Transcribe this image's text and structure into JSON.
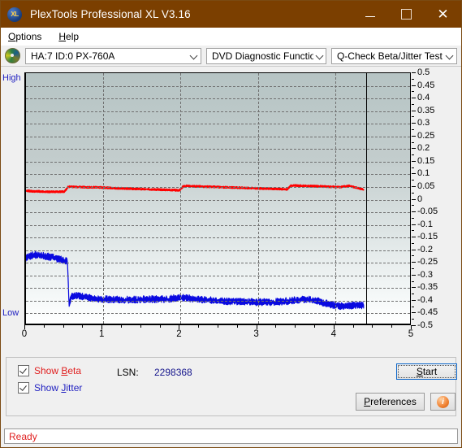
{
  "window": {
    "title": "PlexTools Professional XL V3.16",
    "logo_text": "XL",
    "minimize_label": "–",
    "maximize_label": "",
    "close_label": "✕"
  },
  "menu": {
    "items": [
      {
        "label": "Options",
        "accel": "O"
      },
      {
        "label": "Help",
        "accel": "H"
      }
    ]
  },
  "toolbar": {
    "drive_combo": {
      "value": "HA:7 ID:0  PX-760A",
      "icon": "disc-icon"
    },
    "function_combo": {
      "value": "DVD Diagnostic Functions"
    },
    "test_combo": {
      "value": "Q-Check Beta/Jitter Test"
    }
  },
  "chart_axis": {
    "high_label": "High",
    "low_label": "Low",
    "y_ticks": [
      "0.5",
      "0.45",
      "0.4",
      "0.35",
      "0.3",
      "0.25",
      "0.2",
      "0.15",
      "0.1",
      "0.05",
      "0",
      "-0.05",
      "-0.1",
      "-0.15",
      "-0.2",
      "-0.25",
      "-0.3",
      "-0.35",
      "-0.4",
      "-0.45",
      "-0.5"
    ],
    "x_ticks": [
      "0",
      "1",
      "2",
      "3",
      "4",
      "5"
    ]
  },
  "chart_data": {
    "type": "line",
    "title": "Q-Check Beta/Jitter Test",
    "xlabel": "",
    "ylabel": "",
    "xlim": [
      0,
      5
    ],
    "ylim": [
      -0.5,
      0.5
    ],
    "grid": true,
    "legend_position": "bottom-left",
    "cursor_x": 4.4,
    "series": [
      {
        "name": "Show Beta",
        "color": "#ff0000",
        "x": [
          0.0,
          0.1,
          0.2,
          0.3,
          0.4,
          0.5,
          0.55,
          0.6,
          0.7,
          0.8,
          0.9,
          1.0,
          1.1,
          1.2,
          1.3,
          1.4,
          1.5,
          1.6,
          1.7,
          1.8,
          1.9,
          2.0,
          2.05,
          2.1,
          2.2,
          2.3,
          2.4,
          2.5,
          2.6,
          2.7,
          2.8,
          2.9,
          3.0,
          3.1,
          3.2,
          3.3,
          3.4,
          3.45,
          3.5,
          3.6,
          3.7,
          3.8,
          3.9,
          4.0,
          4.1,
          4.2,
          4.3,
          4.4
        ],
        "y": [
          0.03,
          0.028,
          0.027,
          0.026,
          0.026,
          0.027,
          0.046,
          0.046,
          0.045,
          0.044,
          0.044,
          0.043,
          0.041,
          0.04,
          0.039,
          0.038,
          0.037,
          0.036,
          0.035,
          0.034,
          0.033,
          0.032,
          0.049,
          0.049,
          0.048,
          0.047,
          0.046,
          0.045,
          0.044,
          0.043,
          0.042,
          0.041,
          0.04,
          0.039,
          0.038,
          0.037,
          0.036,
          0.051,
          0.051,
          0.05,
          0.049,
          0.048,
          0.047,
          0.046,
          0.045,
          0.05,
          0.043,
          0.034
        ]
      },
      {
        "name": "Show Jitter",
        "color": "#0a0ae0",
        "x": [
          0.0,
          0.05,
          0.1,
          0.15,
          0.2,
          0.25,
          0.3,
          0.35,
          0.4,
          0.45,
          0.5,
          0.54,
          0.56,
          0.6,
          0.65,
          0.7,
          0.8,
          0.9,
          1.0,
          1.2,
          1.4,
          1.6,
          1.8,
          2.0,
          2.1,
          2.2,
          2.4,
          2.6,
          2.8,
          3.0,
          3.2,
          3.4,
          3.5,
          3.6,
          3.7,
          3.8,
          3.9,
          4.0,
          4.1,
          4.2,
          4.3,
          4.4
        ],
        "y": [
          -0.24,
          -0.232,
          -0.228,
          -0.226,
          -0.228,
          -0.232,
          -0.235,
          -0.238,
          -0.242,
          -0.246,
          -0.25,
          -0.252,
          -0.42,
          -0.392,
          -0.388,
          -0.392,
          -0.398,
          -0.402,
          -0.404,
          -0.406,
          -0.406,
          -0.404,
          -0.404,
          -0.398,
          -0.4,
          -0.404,
          -0.408,
          -0.412,
          -0.414,
          -0.416,
          -0.416,
          -0.412,
          -0.408,
          -0.404,
          -0.406,
          -0.412,
          -0.42,
          -0.428,
          -0.432,
          -0.43,
          -0.428,
          -0.428
        ]
      }
    ]
  },
  "controls": {
    "show_beta": {
      "label": "Show Beta",
      "accel": "B",
      "checked": true,
      "color": "#e02020"
    },
    "show_jitter": {
      "label": "Show Jitter",
      "accel": "J",
      "checked": true,
      "color": "#1f1fc0"
    },
    "lsn_label": "LSN:",
    "lsn_value": "2298368",
    "start_button": "Start",
    "start_accel": "S",
    "preferences_button": "Preferences",
    "preferences_accel": "P",
    "info_button": "i"
  },
  "status": {
    "text": "Ready"
  }
}
